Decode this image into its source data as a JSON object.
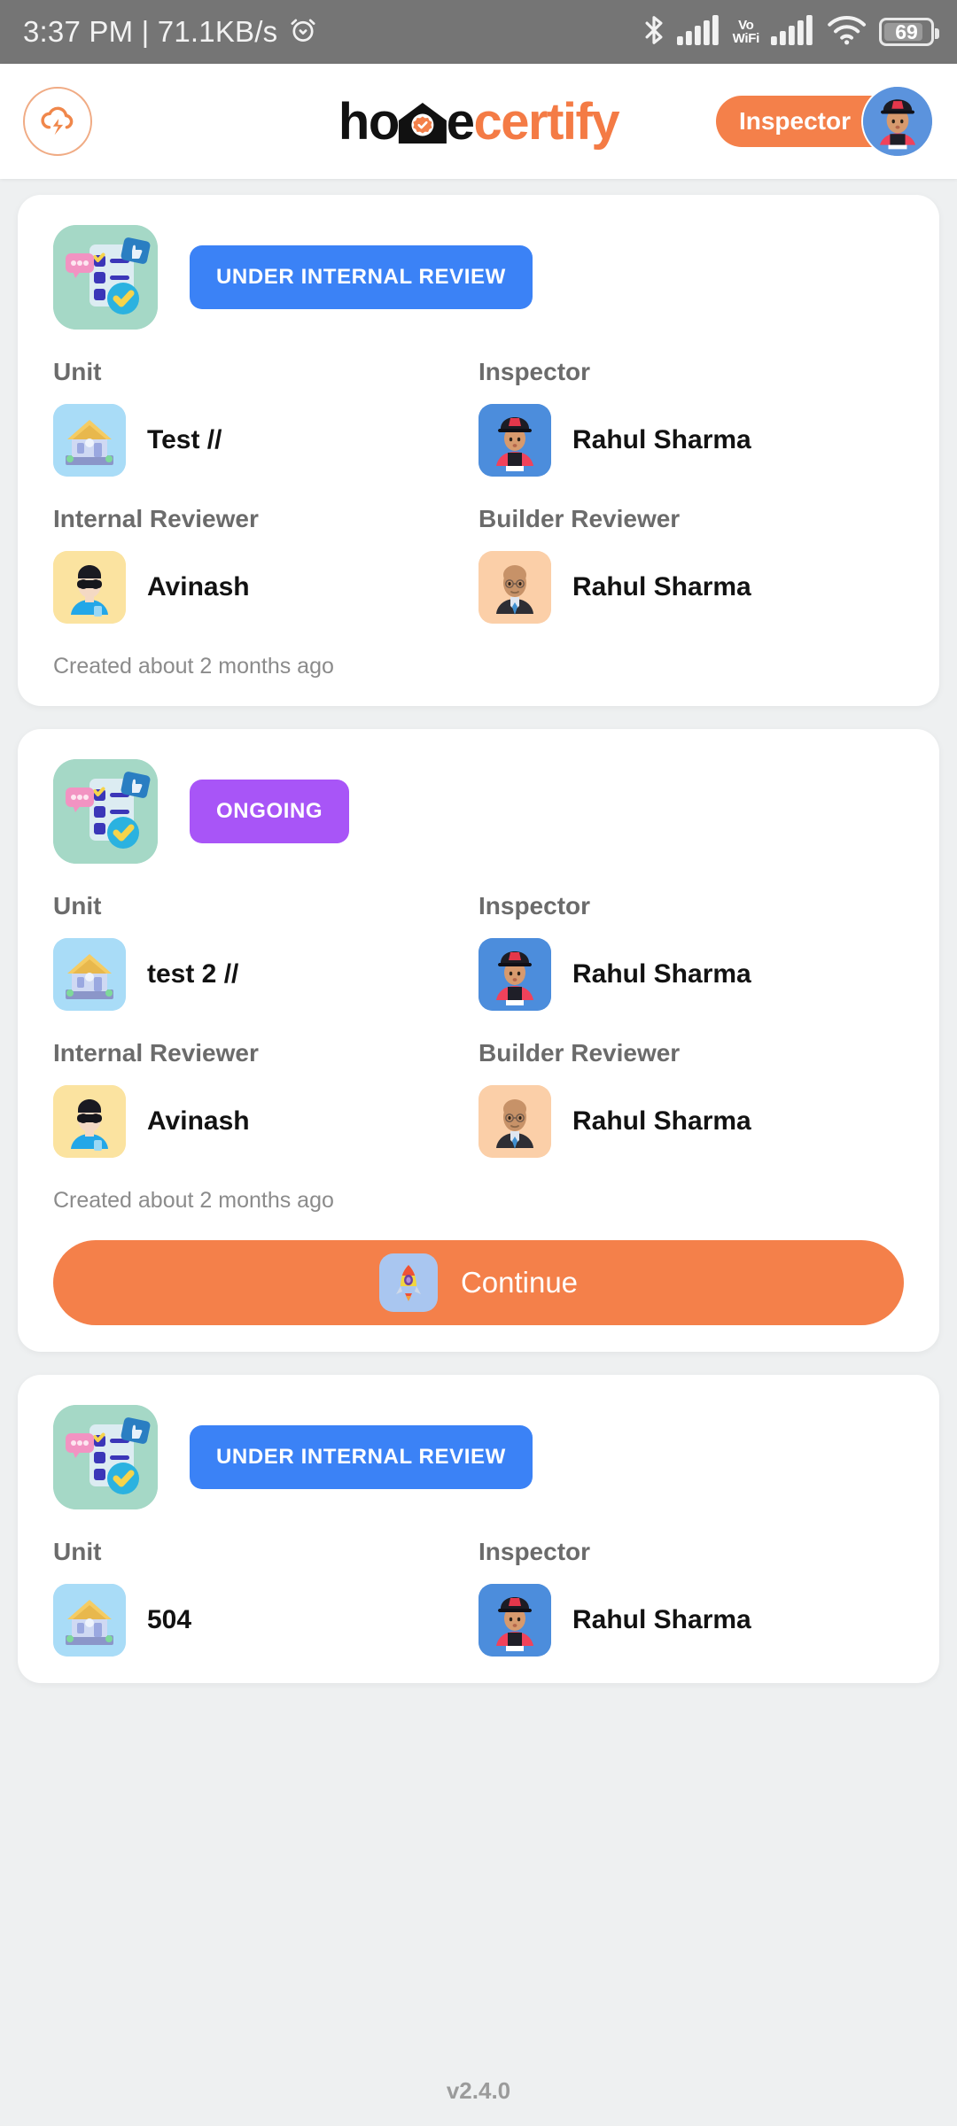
{
  "status_bar": {
    "time_and_speed": "3:37 PM | 71.1KB/s",
    "alarm_icon": "alarm-clock-icon",
    "bluetooth_icon": "bluetooth-icon",
    "signal_icon": "cellular-signal-icon",
    "vowifi_line1": "Vo",
    "vowifi_line2": "WiFi",
    "signal2_icon": "cellular-signal-icon",
    "wifi_icon": "wifi-icon",
    "battery_level": "69"
  },
  "header": {
    "menu_icon": "cloud-lightning-icon",
    "logo_part1": "ho",
    "logo_mark": "house-check-icon",
    "logo_part2": "e",
    "logo_accent": "certify",
    "role_label": "Inspector",
    "avatar_icon": "inspector-avatar-icon"
  },
  "labels": {
    "unit": "Unit",
    "inspector": "Inspector",
    "internal_reviewer": "Internal Reviewer",
    "builder_reviewer": "Builder Reviewer"
  },
  "colors": {
    "accent_orange": "#f4804a",
    "badge_blue": "#3b82f6",
    "badge_purple": "#a855f7",
    "page_bg": "#eef0f1",
    "card_bg": "#ffffff"
  },
  "cards": [
    {
      "doc_icon": "checklist-document-icon",
      "status": "UNDER INTERNAL REVIEW",
      "status_color": "#3b82f6",
      "unit": "Test //",
      "inspector": "Rahul Sharma",
      "internal_reviewer": "Avinash",
      "builder_reviewer": "Rahul Sharma",
      "created": "Created about 2 months ago",
      "has_continue": false,
      "continue_label": "",
      "show_reviewers": true
    },
    {
      "doc_icon": "checklist-document-icon",
      "status": "ONGOING",
      "status_color": "#a855f7",
      "unit": "test 2 //",
      "inspector": "Rahul Sharma",
      "internal_reviewer": "Avinash",
      "builder_reviewer": "Rahul Sharma",
      "created": "Created about 2 months ago",
      "has_continue": true,
      "continue_label": "Continue",
      "show_reviewers": true
    },
    {
      "doc_icon": "checklist-document-icon",
      "status": "UNDER INTERNAL REVIEW",
      "status_color": "#3b82f6",
      "unit": "504",
      "inspector": "Rahul Sharma",
      "internal_reviewer": "",
      "builder_reviewer": "",
      "created": "",
      "has_continue": false,
      "continue_label": "",
      "show_reviewers": false
    }
  ],
  "footer": {
    "version": "v2.4.0"
  }
}
